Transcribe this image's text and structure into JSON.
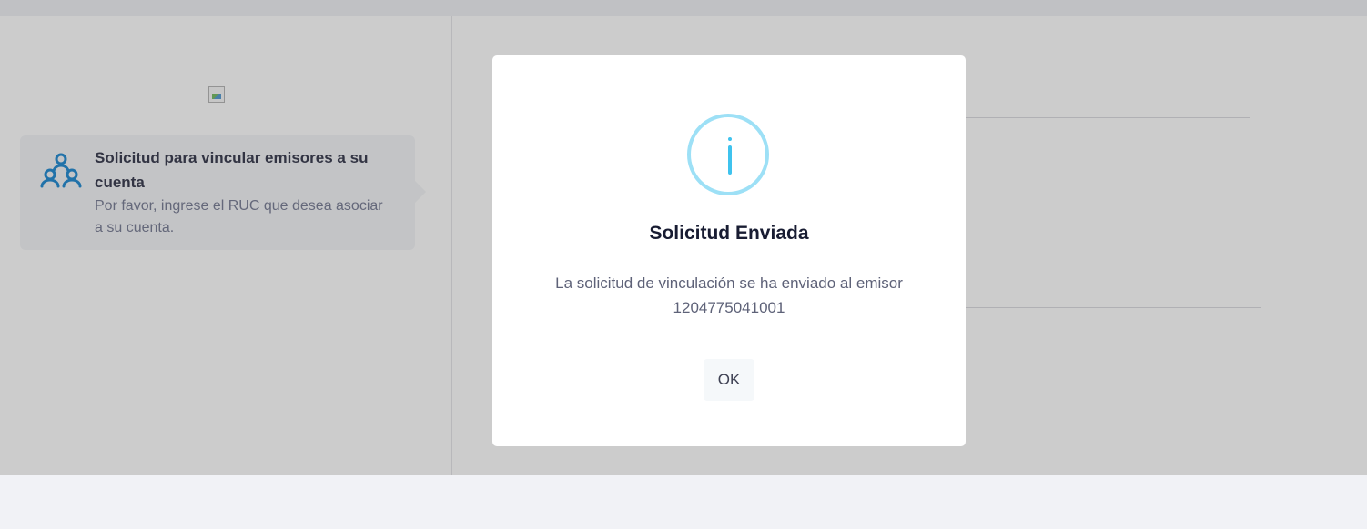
{
  "wizard": {
    "step": {
      "title": "Solicitud para vincular emisores a su cuenta",
      "description": "Por favor, ingrese el RUC que desea asociar a su cuenta.",
      "icon": "users-group-icon"
    }
  },
  "dialog": {
    "icon": "info-icon",
    "title": "Solicitud Enviada",
    "message_line1": "La solicitud de vinculación se ha enviado al emisor",
    "message_line2": "1204775041001",
    "ok_label": "OK",
    "colors": {
      "info": "#3fc3ee",
      "info_ring": "#9de0f6",
      "step_icon": "#2a8fd4"
    }
  }
}
